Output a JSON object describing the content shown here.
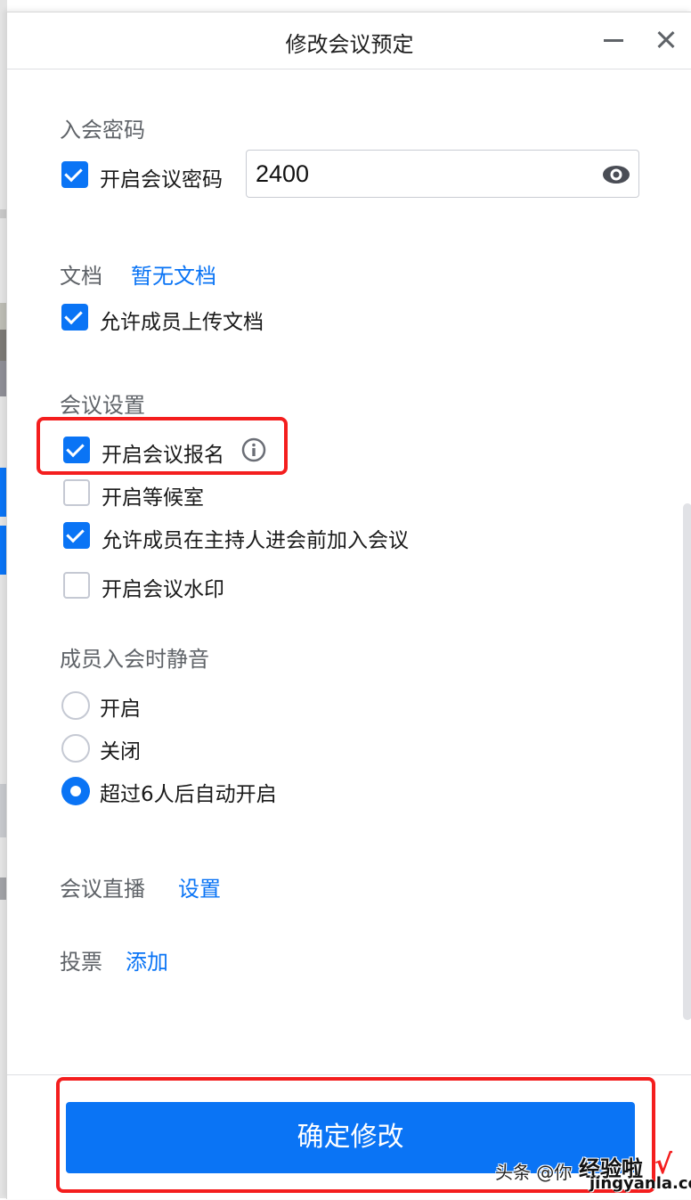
{
  "window": {
    "title": "修改会议预定",
    "minimize_icon": "minimize-icon",
    "close_icon": "close-icon"
  },
  "password_section": {
    "title": "入会密码",
    "enable_label": "开启会议密码",
    "enabled": true,
    "password_value": "2400",
    "visibility_icon": "eye-icon"
  },
  "document_section": {
    "title": "文档",
    "link": "暂无文档",
    "allow_upload_label": "允许成员上传文档",
    "allow_upload": true
  },
  "meeting_settings": {
    "title": "会议设置",
    "options": [
      {
        "label": "开启会议报名",
        "checked": true,
        "has_info_icon": true
      },
      {
        "label": "开启等候室",
        "checked": false
      },
      {
        "label": "允许成员在主持人进会前加入会议",
        "checked": true
      },
      {
        "label": "开启会议水印",
        "checked": false
      }
    ]
  },
  "mute_on_join": {
    "title": "成员入会时静音",
    "options": [
      {
        "label": "开启",
        "selected": false
      },
      {
        "label": "关闭",
        "selected": false
      },
      {
        "label": "超过6人后自动开启",
        "selected": true
      }
    ]
  },
  "live_stream": {
    "title": "会议直播",
    "link": "设置"
  },
  "vote": {
    "title": "投票",
    "link": "添加"
  },
  "footer": {
    "confirm_label": "确定修改"
  },
  "watermark": {
    "text1": "头条 @你",
    "text2": "经验啦",
    "text3": "jingyanla.com",
    "check": "√"
  },
  "colors": {
    "accent": "#0a74f5",
    "annotation": "#f41e1e"
  }
}
